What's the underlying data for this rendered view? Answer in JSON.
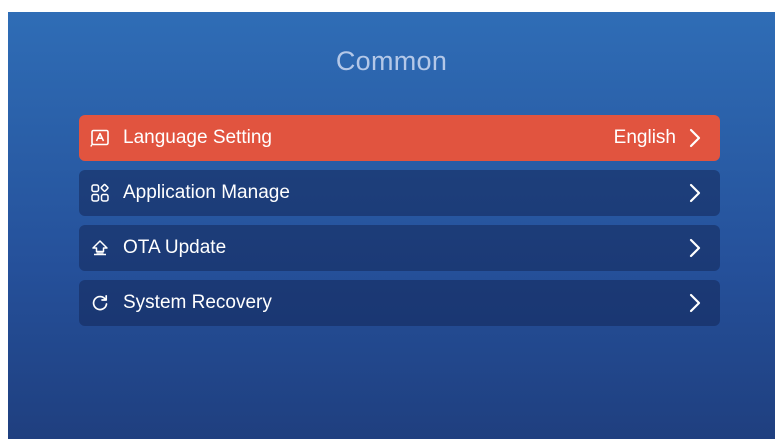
{
  "page": {
    "title": "Common"
  },
  "menu": {
    "items": [
      {
        "icon": "language-icon",
        "label": "Language Setting",
        "value": "English",
        "active": true
      },
      {
        "icon": "apps-grid-icon",
        "label": "Application Manage",
        "value": "",
        "active": false
      },
      {
        "icon": "ota-update-icon",
        "label": "OTA Update",
        "value": "",
        "active": false
      },
      {
        "icon": "recovery-icon",
        "label": "System Recovery",
        "value": "",
        "active": false
      }
    ]
  },
  "colors": {
    "active_item": "#e1543f",
    "background_top": "#2f6db6",
    "background_bottom": "#1f3f7f",
    "title_text": "#b4c8e8"
  }
}
